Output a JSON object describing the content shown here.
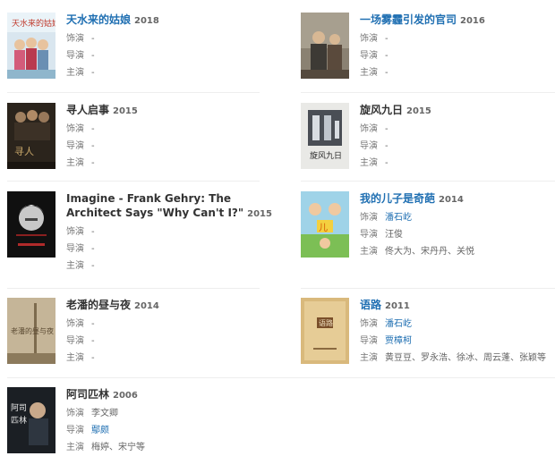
{
  "labels": {
    "role": "饰演",
    "director": "导演",
    "cast": "主演"
  },
  "films": [
    {
      "title": "天水来的姑娘",
      "year": "2018",
      "title_link": true,
      "role": "-",
      "director": "-",
      "cast": "-",
      "role_link": false,
      "director_link": false
    },
    {
      "title": "一场雾霾引发的官司",
      "year": "2016",
      "title_link": true,
      "role": "-",
      "director": "-",
      "cast": "-",
      "role_link": false,
      "director_link": false
    },
    {
      "title": "寻人启事",
      "year": "2015",
      "title_link": false,
      "role": "-",
      "director": "-",
      "cast": "-",
      "role_link": false,
      "director_link": false
    },
    {
      "title": "旋风九日",
      "year": "2015",
      "title_link": false,
      "role": "-",
      "director": "-",
      "cast": "-",
      "role_link": false,
      "director_link": false
    },
    {
      "title": "Imagine - Frank Gehry: The Architect Says \"Why Can't I?\"",
      "year": "2015",
      "title_link": false,
      "role": "-",
      "director": "-",
      "cast": "-",
      "role_link": false,
      "director_link": false
    },
    {
      "title": "我的儿子是奇葩",
      "year": "2014",
      "title_link": true,
      "role": "潘石屹",
      "director": "汪俊",
      "cast": "佟大为、宋丹丹、关悦",
      "role_link": true,
      "director_link": false
    },
    {
      "title": "老潘的昼与夜",
      "year": "2014",
      "title_link": false,
      "role": "-",
      "director": "-",
      "cast": "-",
      "role_link": false,
      "director_link": false
    },
    {
      "title": "语路",
      "year": "2011",
      "title_link": true,
      "role": "潘石屹",
      "director": "贾樟柯",
      "cast": "黄豆豆、罗永浩、徐冰、周云蓬、张颖等",
      "role_link": true,
      "director_link": true
    },
    {
      "title": "阿司匹林",
      "year": "2006",
      "title_link": false,
      "role": "李文卿",
      "director": "鄢颇",
      "cast": "梅婷、宋宁等",
      "role_link": false,
      "director_link": true
    }
  ]
}
